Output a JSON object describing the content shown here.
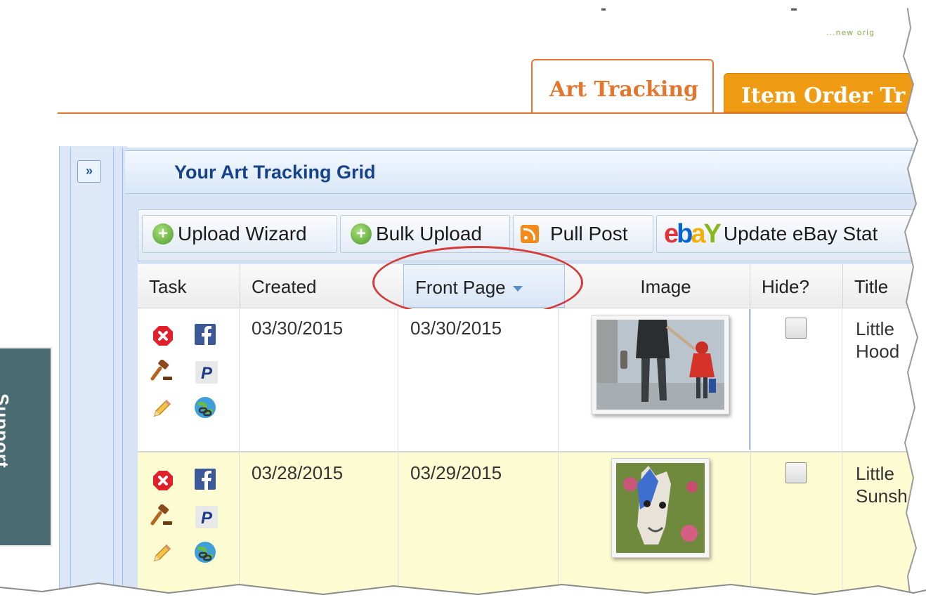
{
  "header": {
    "tagline": "...new orig",
    "tabs": [
      {
        "label": "Art Tracking",
        "active": true
      },
      {
        "label": "Item Order Tr",
        "active": false
      }
    ],
    "accent_color": "#e3762e",
    "inactive_tab_color": "#ef9b13"
  },
  "side_tab": {
    "label": "Support"
  },
  "panel": {
    "expand_label": "»",
    "title": "Your Art Tracking Grid"
  },
  "toolbar": {
    "upload_wizard": "Upload Wizard",
    "bulk_upload": "Bulk Upload",
    "pull_post": "Pull Post",
    "update_ebay": "Update eBay Stat"
  },
  "table": {
    "columns": {
      "task": "Task",
      "created": "Created",
      "front_page": "Front Page",
      "image": "Image",
      "hide": "Hide?",
      "title": "Title"
    },
    "sorted_column": "Front Page",
    "rows": [
      {
        "created": "03/30/2015",
        "front_page": "03/30/2015",
        "image_subject": "painting-girl-red-coat",
        "hidden": false,
        "title_line1": "Little",
        "title_line2": "Hood"
      },
      {
        "created": "03/28/2015",
        "front_page": "03/29/2015",
        "image_subject": "painting-llama-blue",
        "hidden": false,
        "title_line1": "Little",
        "title_line2": "Sunsh"
      }
    ],
    "row_highlight_color": "#fdfbd2"
  },
  "task_icons": [
    "delete-icon",
    "facebook-icon",
    "auction-gavel-icon",
    "paypal-icon",
    "edit-pencil-icon",
    "link-globe-icon"
  ]
}
